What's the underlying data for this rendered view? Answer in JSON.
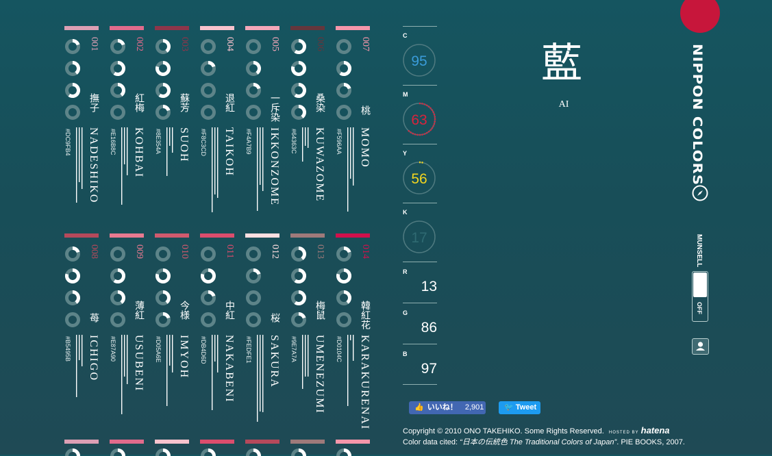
{
  "colors": [
    {
      "num": "001",
      "jp": "撫子",
      "ro": "NADESHIKO",
      "hex": "#DC9FB4",
      "c": 1,
      "m": 2,
      "y": 3,
      "k": 0,
      "num_color": "#dc9fb4"
    },
    {
      "num": "002",
      "jp": "紅梅",
      "ro": "KOHBAI",
      "hex": "#E16B8C",
      "c": 1,
      "m": 3,
      "y": 2,
      "k": 0,
      "num_color": "#e16b8c"
    },
    {
      "num": "003",
      "jp": "蘇芳",
      "ro": "SUOH",
      "hex": "#8E354A",
      "c": 2,
      "m": 4,
      "y": 3,
      "k": 1,
      "num_color": "#8e354a"
    },
    {
      "num": "004",
      "jp": "退紅",
      "ro": "TAIKOH",
      "hex": "#F8C3CD",
      "c": 0,
      "m": 1,
      "y": 0,
      "k": 0,
      "num_color": "#f8c3cd"
    },
    {
      "num": "005",
      "jp": "一斥染",
      "ro": "IKKONZOME",
      "hex": "#F4A7B9",
      "c": 0,
      "m": 2,
      "y": 1,
      "k": 0,
      "num_color": "#f4a7b9"
    },
    {
      "num": "006",
      "jp": "桑染",
      "ro": "KUWAZOME",
      "hex": "#64363C",
      "c": 3,
      "m": 4,
      "y": 3,
      "k": 2,
      "num_color": "#64363c"
    },
    {
      "num": "007",
      "jp": "桃",
      "ro": "MOMO",
      "hex": "#F596AA",
      "c": 0,
      "m": 3,
      "y": 1,
      "k": 0,
      "num_color": "#f596aa"
    },
    {
      "num": "008",
      "jp": "苺",
      "ro": "ICHIGO",
      "hex": "#B5495B",
      "c": 1,
      "m": 4,
      "y": 2,
      "k": 0,
      "num_color": "#b5495b"
    },
    {
      "num": "009",
      "jp": "薄紅",
      "ro": "USUBENI",
      "hex": "#E87A90",
      "c": 0,
      "m": 3,
      "y": 2,
      "k": 0,
      "num_color": "#e87a90"
    },
    {
      "num": "010",
      "jp": "今様",
      "ro": "IMYOH",
      "hex": "#D05A6E",
      "c": 0,
      "m": 4,
      "y": 2,
      "k": 1,
      "num_color": "#d05a6e"
    },
    {
      "num": "011",
      "jp": "中紅",
      "ro": "NAKABENI",
      "hex": "#DB4D6D",
      "c": 0,
      "m": 4,
      "y": 1,
      "k": 0,
      "num_color": "#db4d6d"
    },
    {
      "num": "012",
      "jp": "桜",
      "ro": "SAKURA",
      "hex": "#FEDFE1",
      "c": 0,
      "m": 1,
      "y": 0,
      "k": 0,
      "num_color": "#fedfe1"
    },
    {
      "num": "013",
      "jp": "梅鼠",
      "ro": "UMENEZUMI",
      "hex": "#9E7A7A",
      "c": 2,
      "m": 3,
      "y": 3,
      "k": 1,
      "num_color": "#9e7a7a"
    },
    {
      "num": "014",
      "jp": "韓紅花",
      "ro": "KARAKURENAI",
      "hex": "#D0104C",
      "c": 1,
      "m": 4,
      "y": 2,
      "k": 0,
      "num_color": "#d0104c"
    }
  ],
  "row3_swatches": [
    "#dc9fb4",
    "#e16b8c",
    "#f8c3cd",
    "#db4d6d",
    "#b5495b",
    "#9e7a7a",
    "#f596aa"
  ],
  "cmyk": [
    {
      "label": "C",
      "value": "95",
      "color": "#3a9bd9",
      "fraction": 0.0
    },
    {
      "label": "M",
      "value": "63",
      "color": "#d9233c",
      "fraction": 0.63
    },
    {
      "label": "Y",
      "value": "56",
      "color": "#f2d51f",
      "fraction": 0.04
    },
    {
      "label": "K",
      "value": "17",
      "color": "#2f6a72",
      "fraction": 0.0
    }
  ],
  "rgb": [
    {
      "label": "R",
      "value": "13"
    },
    {
      "label": "G",
      "value": "86"
    },
    {
      "label": "B",
      "value": "97"
    }
  ],
  "selected": {
    "kanji": "藍",
    "romaji": "AI"
  },
  "brand": {
    "name": "NIPPON COLORS",
    "accent": "#c7163b"
  },
  "munsell": {
    "label": "MUNSELL",
    "toggle_state": "OFF"
  },
  "social": {
    "like_label": "いいね！",
    "like_count": "2,901",
    "tweet_label": "Tweet"
  },
  "footer": {
    "copyright": "Copyright © 2010 ONO TAKEHIKO. Some Rights Reserved.",
    "hosted_by": "HOSTED BY",
    "host": "hatena",
    "cited_prefix": "Color data cited: ",
    "cited_title": "“日本の伝統色 The Traditional Colors of Japan”",
    "cited_suffix": ". PIE BOOKS, 2007."
  }
}
